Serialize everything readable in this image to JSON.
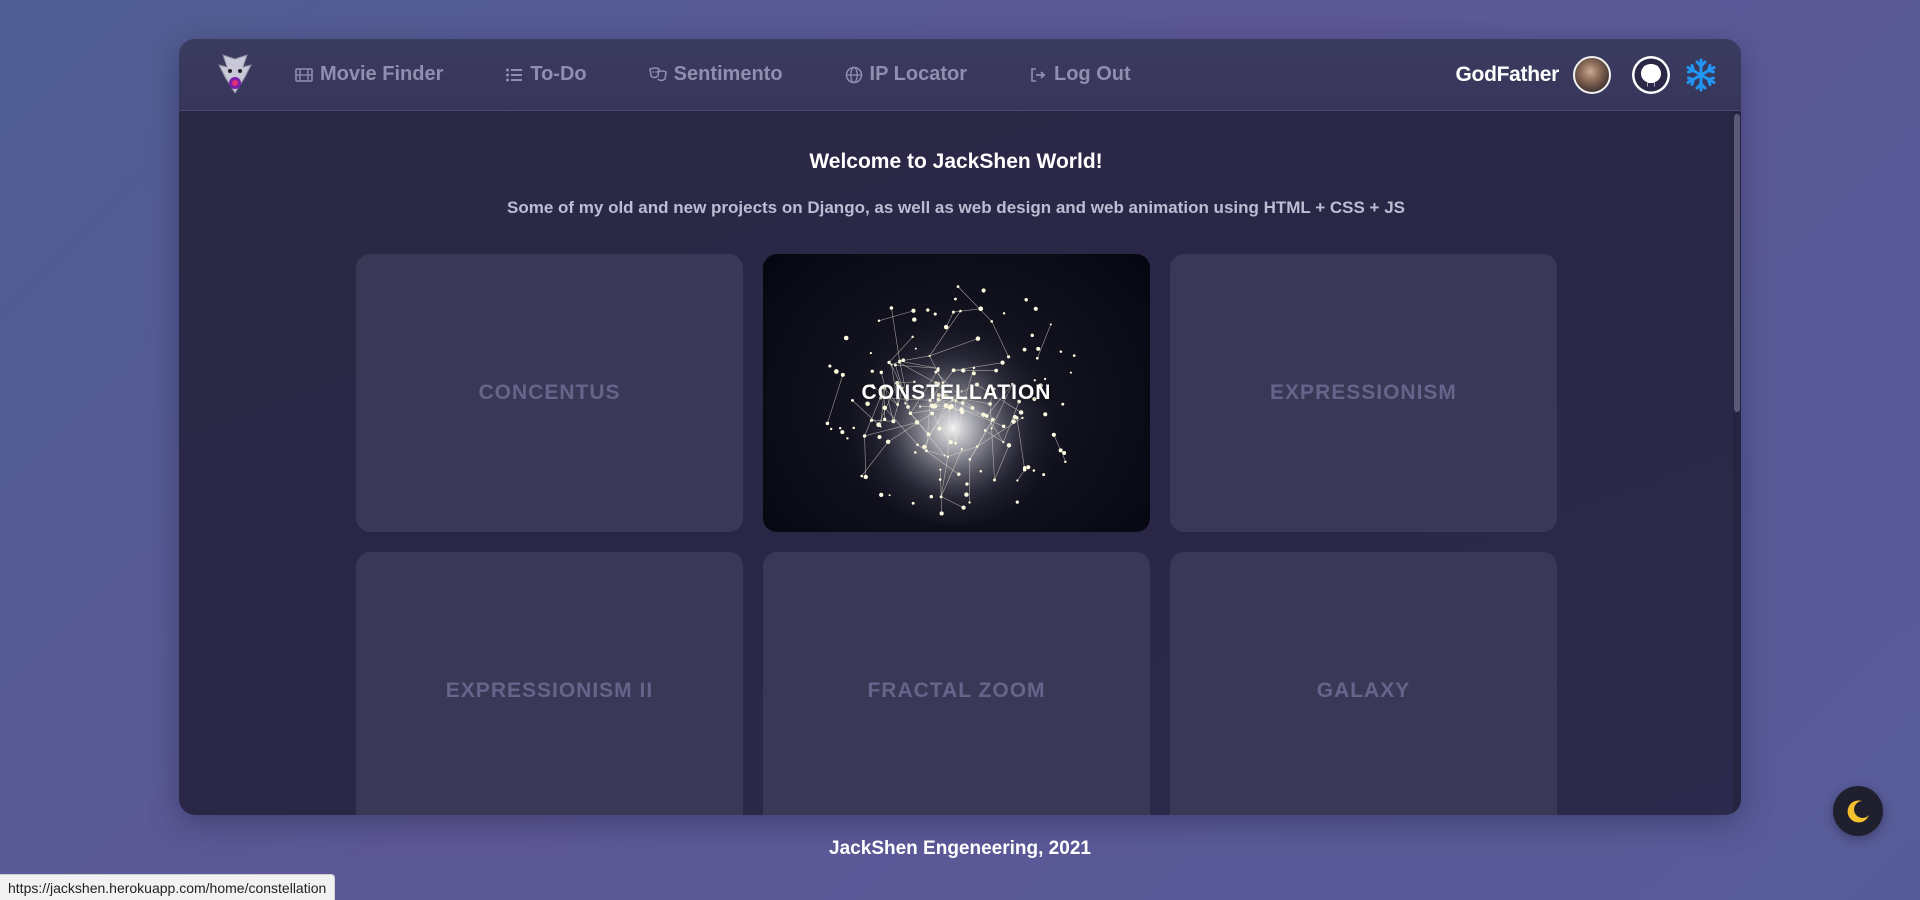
{
  "nav": {
    "items": [
      {
        "label": "Movie Finder",
        "icon": "film-icon"
      },
      {
        "label": "To-Do",
        "icon": "list-icon"
      },
      {
        "label": "Sentimento",
        "icon": "masks-icon"
      },
      {
        "label": "IP Locator",
        "icon": "globe-icon"
      },
      {
        "label": "Log Out",
        "icon": "sign-out-icon"
      }
    ],
    "username": "GodFather"
  },
  "main": {
    "title": "Welcome to JackShen World!",
    "subtitle": "Some of my old and new projects on Django, as well as web design and web animation using HTML + CSS + JS",
    "cards": [
      {
        "label": "CONCENTUS",
        "active": false
      },
      {
        "label": "CONSTELLATION",
        "active": true
      },
      {
        "label": "EXPRESSIONISM",
        "active": false
      },
      {
        "label": "EXPRESSIONISM II",
        "active": false
      },
      {
        "label": "FRACTAL ZOOM",
        "active": false
      },
      {
        "label": "GALAXY",
        "active": false
      }
    ]
  },
  "footer": {
    "text": "JackShen Engeneering, 2021"
  },
  "statusbar": {
    "url": "https://jackshen.herokuapp.com/home/constellation"
  },
  "colors": {
    "snowflake": "#2196f3",
    "moon": "#f5c12e",
    "nav_text": "#8f8fb0"
  }
}
